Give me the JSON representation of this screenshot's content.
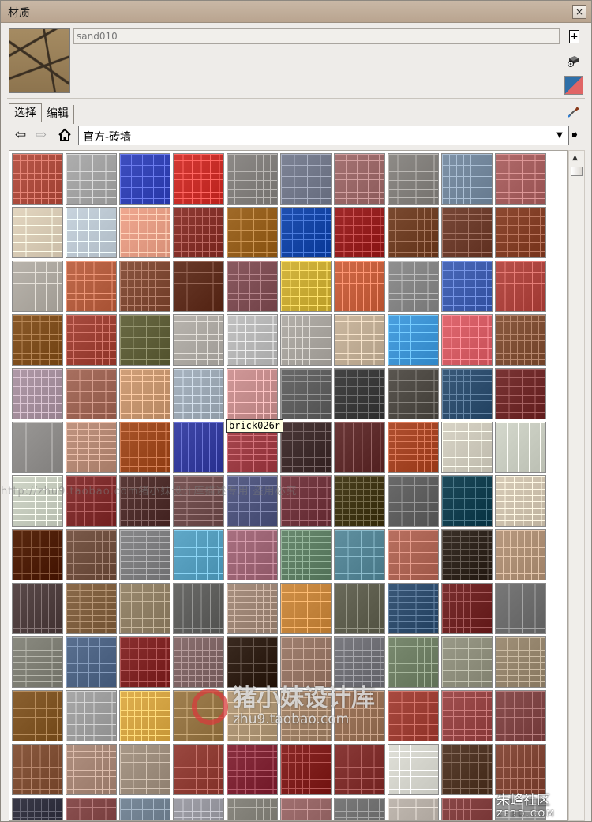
{
  "window": {
    "title": "材质",
    "close_glyph": "×"
  },
  "material": {
    "name": "sand010",
    "preview_icon": "sand-texture-thumbnail"
  },
  "side_buttons": {
    "new_icon": "create-material-icon",
    "sample_icon": "sample-paint-icon",
    "swatch_icon": "default-swatch-icon",
    "eyedrop_icon": "eyedropper-icon"
  },
  "tabs": [
    {
      "label": "选择"
    },
    {
      "label": "编辑"
    }
  ],
  "nav": {
    "back_glyph": "⇦",
    "forward_glyph": "⇨",
    "home_glyph": "⌂",
    "collection": "官方-砖墙",
    "dropdown_glyph": "▼",
    "details_glyph": "➧"
  },
  "scroll": {
    "up_glyph": "▲"
  },
  "tooltip": "brick026r",
  "watermarks": {
    "line": "http://zhu9.taobao.com猪小妹设计库描述专用 盗用必究",
    "logo_cn": "猪小妹设计库",
    "logo_url": "zhu9.taobao.com",
    "corner_cn": "朱峰社区",
    "corner_url": "ZF3D.COM"
  },
  "swatches": [
    [
      "#b8584a",
      "#aeaeae",
      "#3f4fc0",
      "#d43a35",
      "#8d8a87",
      "#7e8496",
      "#a57373",
      "#8e8b87",
      "#7f93a8",
      "#b06a6a"
    ],
    [
      "#e3d6c0",
      "#c8d4de",
      "#f0a890",
      "#8f3c35",
      "#a06a28",
      "#2050b0",
      "#a02a2a",
      "#7a4a30",
      "#784838",
      "#8e4a32"
    ],
    [
      "#b9b4ac",
      "#c06a4c",
      "#8a5540",
      "#6a3a2a",
      "#8a5a60",
      "#d4b640",
      "#d06a48",
      "#909090",
      "#4a68b8",
      "#b8504a"
    ],
    [
      "#8a5a2a",
      "#a84c40",
      "#6a6a45",
      "#b8b4ae",
      "#c2c2c2",
      "#b4b0aa",
      "#cbb8a0",
      "#4aa0e0",
      "#e06870",
      "#8a5a40"
    ],
    [
      "#b09aa8",
      "#a87060",
      "#d0a07a",
      "#a8b4c0",
      "#d09898",
      "#6a6a6a",
      "#454545",
      "#5a5650",
      "#3a5a7a",
      "#7a3535"
    ],
    [
      "#9a9896",
      "#c09480",
      "#a8542a",
      "#4048a8",
      "#a84850",
      "#4a3838",
      "#6a3838",
      "#b05030",
      "#d8d4c6",
      "#d4d8cc"
    ],
    [
      "#d0d6c8",
      "#8a3838",
      "#5a3a38",
      "#7a5858",
      "#5a6088",
      "#7a4048",
      "#4a4020",
      "#6a6a6a",
      "#1e4a5a",
      "#d8ccb8"
    ],
    [
      "#5a2a10",
      "#7a5a4a",
      "#88888a",
      "#60a8c8",
      "#a87080",
      "#6a8a70",
      "#6090a0",
      "#b87060",
      "#3a3028",
      "#b89a80"
    ],
    [
      "#5a4a4a",
      "#8a6a4a",
      "#9a8a70",
      "#6a6a68",
      "#a89080",
      "#d09048",
      "#6a6a5a",
      "#3a5878",
      "#7a3030",
      "#787878"
    ],
    [
      "#8a8a80",
      "#5a7090",
      "#8a3030",
      "#8a7070",
      "#3a2a20",
      "#a08070",
      "#7a7a80",
      "#7a8a70",
      "#9a9a88",
      "#a09078"
    ],
    [
      "#8a6030",
      "#a8a8a8",
      "#e0b050",
      "#a08050",
      "#b8a080",
      "#a88a70",
      "#a07a60",
      "#a84a40",
      "#a05050",
      "#8a5050"
    ],
    [
      "#8a5a40",
      "#b09080",
      "#a89888",
      "#9a4840",
      "#8a3040",
      "#8a2a28",
      "#8a3a38",
      "#e0e0d8",
      "#5a4030",
      "#8a5040"
    ],
    [
      "#3a3a48",
      "#8a5050",
      "#7a8a9a",
      "#a0a0a8",
      "#8a8880",
      "#a07070",
      "#7a7a7a",
      "#c0b8b0",
      "#8a4848",
      "#9a9a9a"
    ]
  ]
}
